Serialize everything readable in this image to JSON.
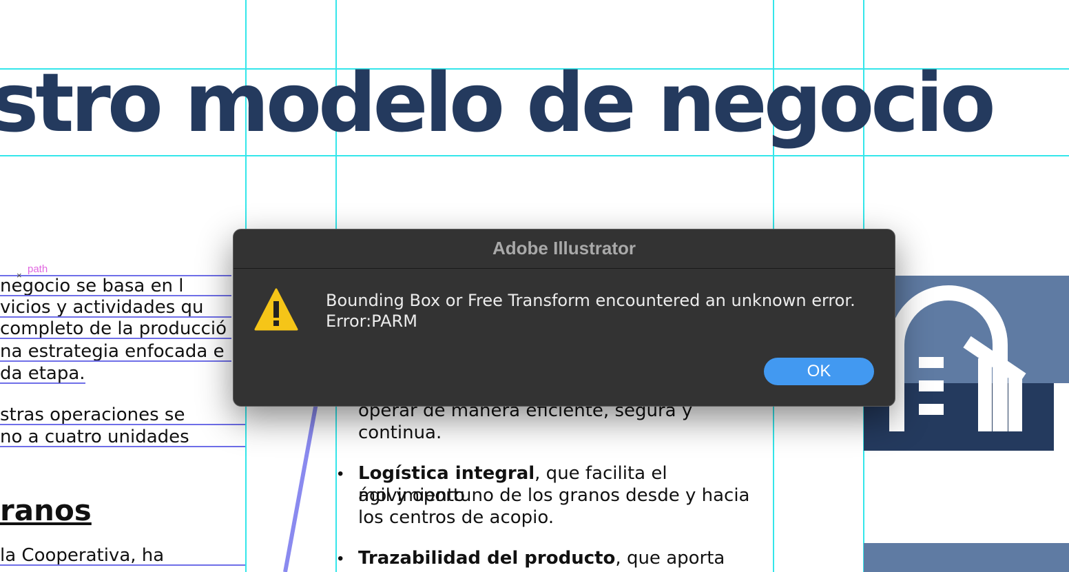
{
  "document": {
    "headline": "stro modelo de negocio",
    "left_lines": [
      "negocio se basa en l",
      "vicios y actividades qu",
      "completo de la producció",
      "na estrategia enfocada e",
      "da etapa.",
      "stras   operaciones   se",
      "no  a  cuatro  unidades"
    ],
    "selection_label": "path",
    "subheading": "ranos",
    "left_bottom_line": "   la   Cooperativa,   ha",
    "right_lines": {
      "partial_1": "operar  de  manera  eficiente,  segura  y",
      "partial_2": "continua.",
      "item1_bold": "Logística integral",
      "item1_rest": ", que facilita el movimiento",
      "item1_line2": "ágil y oportuno de los granos desde y hacia",
      "item1_line3": "los centros de acopio.",
      "item2_bold": "Trazabilidad   del   producto",
      "item2_rest": ",   que   aporta"
    },
    "bullet": "•"
  },
  "dialog": {
    "title": "Adobe Illustrator",
    "message_line1": "Bounding Box or Free Transform encountered an unknown error.",
    "message_line2": "Error:PARM",
    "ok_label": "OK",
    "icon": "warning-icon"
  },
  "colors": {
    "headline": "#243a5e",
    "guides": "#33e6ea",
    "dialog_bg": "#333333",
    "ok_button": "#4299f1",
    "warning": "#f5c518"
  }
}
